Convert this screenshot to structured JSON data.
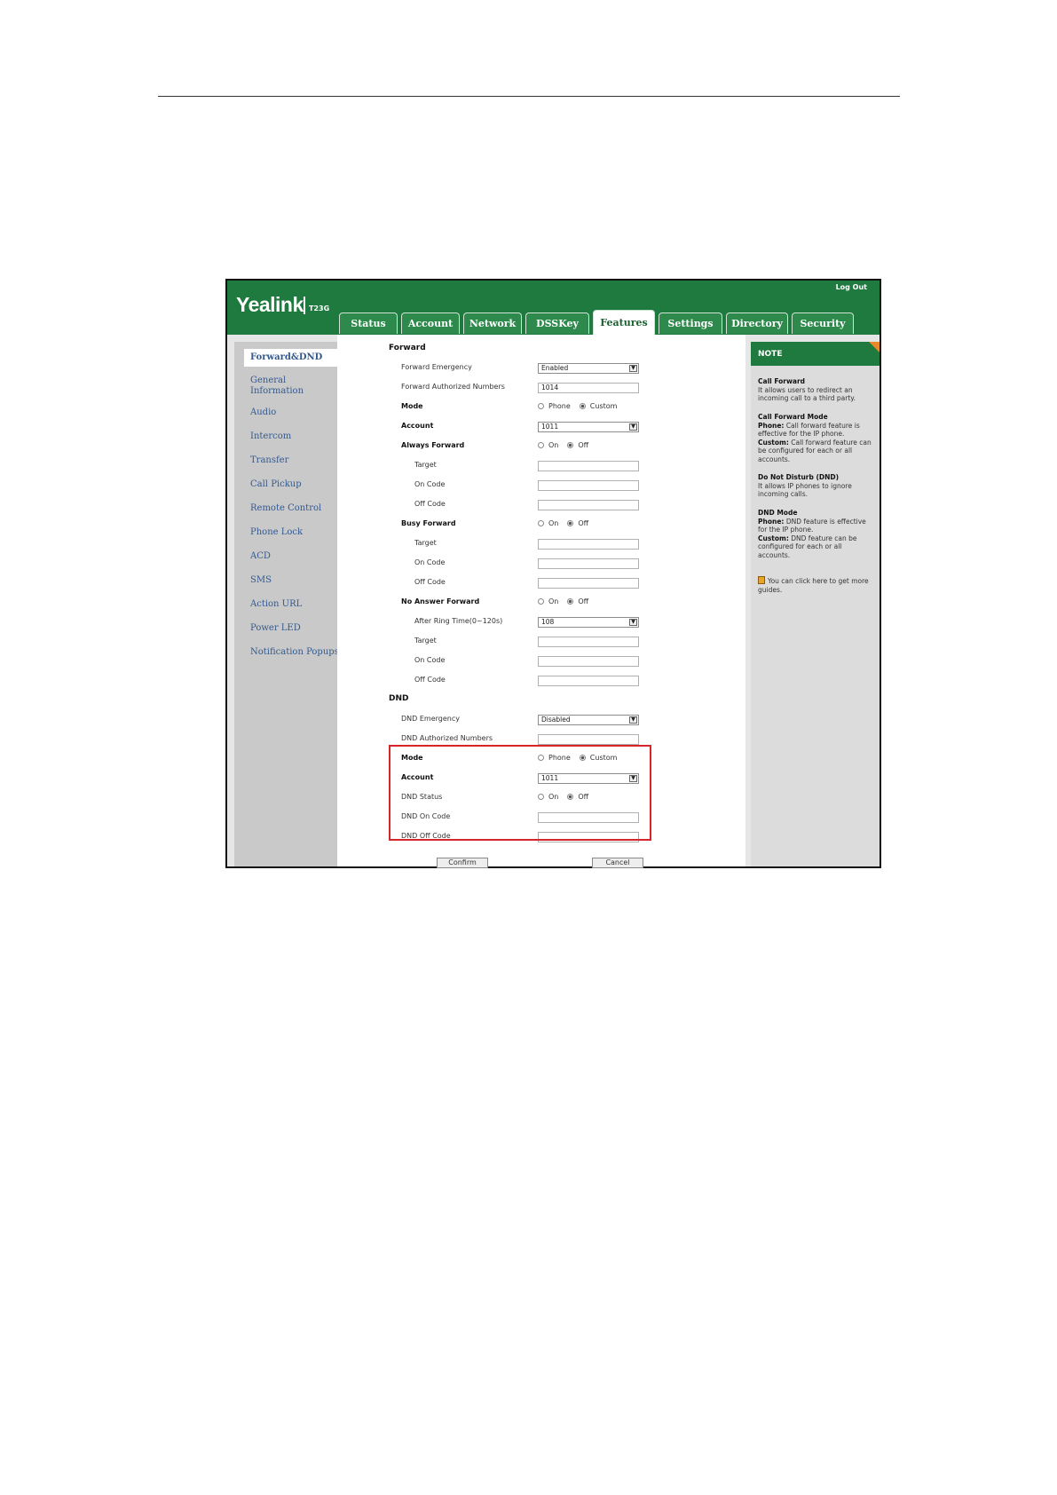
{
  "app": {
    "logo": "Yealink",
    "model": "T23G",
    "logout": "Log Out"
  },
  "tabs": [
    "Status",
    "Account",
    "Network",
    "DSSKey",
    "Features",
    "Settings",
    "Directory",
    "Security"
  ],
  "active_tab": "Features",
  "nav": [
    "Forward&DND",
    "General Information",
    "Audio",
    "Intercom",
    "Transfer",
    "Call Pickup",
    "Remote Control",
    "Phone Lock",
    "ACD",
    "SMS",
    "Action URL",
    "Power LED",
    "Notification Popups"
  ],
  "forward": {
    "title": "Forward",
    "emergency_label": "Forward Emergency",
    "emergency_value": "Enabled",
    "authorized_label": "Forward Authorized Numbers",
    "authorized_value": "1014",
    "mode_label": "Mode",
    "mode_phone": "Phone",
    "mode_custom": "Custom",
    "account_label": "Account",
    "account_value": "1011",
    "always_label": "Always Forward",
    "busy_label": "Busy Forward",
    "noanswer_label": "No Answer Forward",
    "on": "On",
    "off": "Off",
    "target": "Target",
    "on_code": "On Code",
    "off_code": "Off Code",
    "ring_label": "After Ring Time(0~120s)",
    "ring_value": "108"
  },
  "dnd": {
    "title": "DND",
    "emergency_label": "DND Emergency",
    "emergency_value": "Disabled",
    "authorized_label": "DND Authorized Numbers",
    "mode_label": "Mode",
    "mode_phone": "Phone",
    "mode_custom": "Custom",
    "account_label": "Account",
    "account_value": "1011",
    "status_label": "DND Status",
    "on": "On",
    "off": "Off",
    "on_code_label": "DND On Code",
    "off_code_label": "DND Off Code"
  },
  "buttons": {
    "confirm": "Confirm",
    "cancel": "Cancel"
  },
  "note": {
    "header": "NOTE",
    "cf_title": "Call Forward",
    "cf_text": "It allows users to redirect an incoming call to a third party.",
    "cfm_title": "Call Forward Mode",
    "cfm_phone_label": "Phone:",
    "cfm_phone_text": "Call forward feature is effective for the IP phone.",
    "cfm_custom_label": "Custom:",
    "cfm_custom_text": "Call forward feature can be configured for each or all accounts.",
    "dnd_title": "Do Not Disturb (DND)",
    "dnd_text": "It allows IP phones to ignore incoming calls.",
    "dndm_title": "DND Mode",
    "dndm_phone_label": "Phone:",
    "dndm_phone_text": "DND feature is effective for the IP phone.",
    "dndm_custom_label": "Custom:",
    "dndm_custom_text": "DND feature can be configured for each or all accounts.",
    "guide": "You can click here to get more guides."
  },
  "colors": {
    "brand_green": "#1e7a3e",
    "highlight_red": "#d6262b",
    "nav_link": "#33598f"
  }
}
